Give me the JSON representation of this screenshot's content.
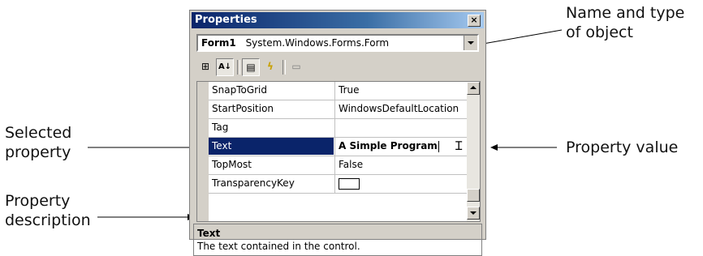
{
  "window": {
    "title": "Properties",
    "close_glyph": "×",
    "object_selector": {
      "name": "Form1",
      "type": "System.Windows.Forms.Form"
    }
  },
  "toolbar": {
    "buttons": [
      {
        "icon": "categorized-icon",
        "glyph": "⊞"
      },
      {
        "icon": "alphabetical-icon",
        "glyph": "A↓"
      },
      {
        "icon": "properties-icon",
        "glyph": "▤"
      },
      {
        "icon": "events-icon",
        "glyph": "ϟ"
      },
      {
        "icon": "property-pages-icon",
        "glyph": "▭"
      }
    ]
  },
  "properties": [
    {
      "name": "SnapToGrid",
      "value": "True"
    },
    {
      "name": "StartPosition",
      "value": "WindowsDefaultLocation"
    },
    {
      "name": "Tag",
      "value": ""
    },
    {
      "name": "Text",
      "value": "A Simple Program"
    },
    {
      "name": "TopMost",
      "value": "False"
    },
    {
      "name": "TransparencyKey",
      "value": ""
    }
  ],
  "description": {
    "title": "Text",
    "text": "The text contained in the control."
  },
  "callouts": {
    "name_type_1": "Name and type",
    "name_type_2": "of object",
    "selected_1": "Selected",
    "selected_2": "property",
    "value": "Property value",
    "desc_1": "Property",
    "desc_2": "description"
  },
  "colors": {
    "title_bar": "#0a246a",
    "selection": "#0a246a",
    "chrome": "#d4d0c8"
  }
}
